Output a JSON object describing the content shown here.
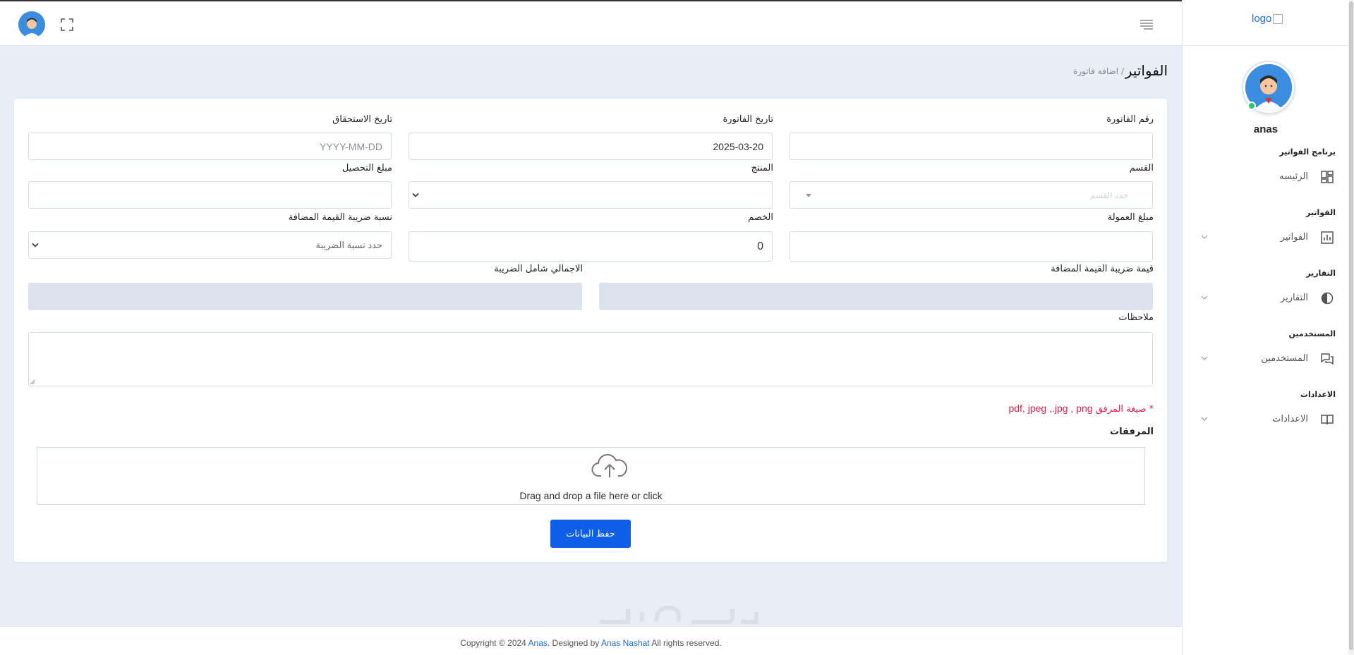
{
  "sidebar": {
    "logo_alt": "logo",
    "profile_name": "anas",
    "app_heading": "برنامج الفواتير",
    "home": "الرئيسه",
    "sections": [
      {
        "heading": "الفواتير",
        "item": "الفواتير"
      },
      {
        "heading": "التقارير",
        "item": "التقارير"
      },
      {
        "heading": "المستخدمين",
        "item": "المستخدمين"
      },
      {
        "heading": "الاعدادات",
        "item": "الاعدادات"
      }
    ]
  },
  "header": {
    "page_title": "الفواتير",
    "breadcrumb": "/ اضافة فاتورة"
  },
  "form": {
    "invoice_number": {
      "label": "رقم الفاتورة",
      "value": ""
    },
    "invoice_date": {
      "label": "تاريخ الفاتورة",
      "value": "2025-03-20"
    },
    "due_date": {
      "label": "تاريخ الاستحقاق",
      "placeholder": "YYYY-MM-DD"
    },
    "section": {
      "label": "القسم",
      "placeholder": "حدد القسم"
    },
    "product": {
      "label": "المنتج",
      "value": ""
    },
    "collection_amount": {
      "label": "مبلغ التحصيل",
      "value": ""
    },
    "commission_amount": {
      "label": "مبلغ العمولة",
      "value": ""
    },
    "discount": {
      "label": "الخصم",
      "value": "0"
    },
    "vat_rate": {
      "label": "نسبة ضريبة القيمة المضافة",
      "placeholder": "حدد نسبة الضريبة"
    },
    "vat_value": {
      "label": "قيمة ضريبة القيمة المضافة",
      "value": ""
    },
    "total_with_tax": {
      "label": "الاجمالي شامل الضريبة",
      "value": ""
    },
    "notes": {
      "label": "ملاحظات",
      "value": ""
    },
    "format_prefix": "* صيغة المرفق",
    "format_list": "pdf, jpeg ,.jpg , png",
    "attachments_label": "المرفقات",
    "dropzone_text": "Drag and drop a file here or click",
    "save_label": "حفظ البيانات"
  },
  "footer": {
    "prefix": "Copyright © 2024 ",
    "brand": "Anas",
    "designed_by": ". Designed by ",
    "author": "Anas Nashat",
    "suffix": " All rights reserved."
  },
  "colors": {
    "primary": "#0f5ee8",
    "link": "#1e6fd6",
    "danger": "#e0234a",
    "background": "#e9edf7",
    "readonly_field": "#dde1ee"
  },
  "icons": [
    "fullscreen-icon",
    "menu-icon",
    "dashboard-icon",
    "bar-chart-icon",
    "pie-chart-icon",
    "chat-icon",
    "book-icon",
    "chevron-down-icon",
    "cloud-upload-icon"
  ]
}
